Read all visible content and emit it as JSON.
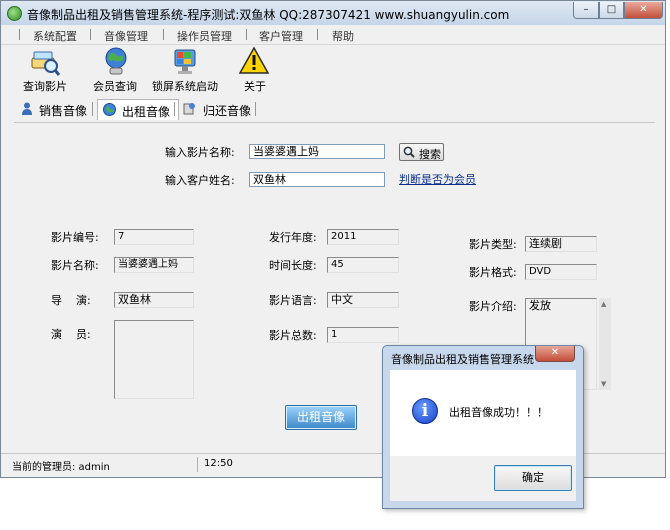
{
  "window": {
    "title": "音像制品出租及销售管理系统-程序测试:双鱼林 QQ:287307421 www.shuangyulin.com",
    "min_glyph": "–",
    "max_glyph": "□",
    "close_glyph": "✕"
  },
  "menu": [
    "系统配置",
    "音像管理",
    "操作员管理",
    "客户管理",
    "帮助"
  ],
  "toolbar": [
    {
      "label": "查询影片",
      "icon": "film-search-icon"
    },
    {
      "label": "会员查询",
      "icon": "globe-person-icon"
    },
    {
      "label": "锁屏系统启动",
      "icon": "lock-screen-icon"
    },
    {
      "label": "关于",
      "icon": "warning-icon"
    }
  ],
  "tabs": [
    {
      "label": "销售音像",
      "active": false
    },
    {
      "label": "出租音像",
      "active": true
    },
    {
      "label": "归还音像",
      "active": false
    }
  ],
  "search": {
    "film_name_label": "输入影片名称:",
    "film_name_value": "当婆婆遇上妈",
    "search_button": "搜索",
    "customer_label": "输入客户姓名:",
    "customer_value": "双鱼林",
    "check_member_link": "判断是否为会员"
  },
  "details": {
    "film_id_label": "影片编号:",
    "film_id": "7",
    "film_name_label": "影片名称:",
    "film_name": "当婆婆遇上妈",
    "director_label": "导    演:",
    "director": "双鱼林",
    "actors_label": "演    员:",
    "actors": "",
    "release_year_label": "发行年度:",
    "release_year": "2011",
    "duration_label": "时间长度:",
    "duration": "45",
    "language_label": "影片语言:",
    "language": "中文",
    "total_label": "影片总数:",
    "total": "1",
    "type_label": "影片类型:",
    "type": "连续剧",
    "format_label": "影片格式:",
    "format": "DVD",
    "intro_label": "影片介绍:",
    "intro": "发放"
  },
  "rent_button": "出租音像",
  "status": {
    "admin": "当前的管理员: admin",
    "time": "12:50"
  },
  "dialog": {
    "title": "音像制品出租及销售管理系统",
    "close_glyph": "✕",
    "message": "出租音像成功！！！",
    "ok_button": "确定"
  },
  "colors": {
    "accent_button": "#3b87c9",
    "link": "#0b2f8a",
    "info_icon": "#1a4fd6"
  }
}
